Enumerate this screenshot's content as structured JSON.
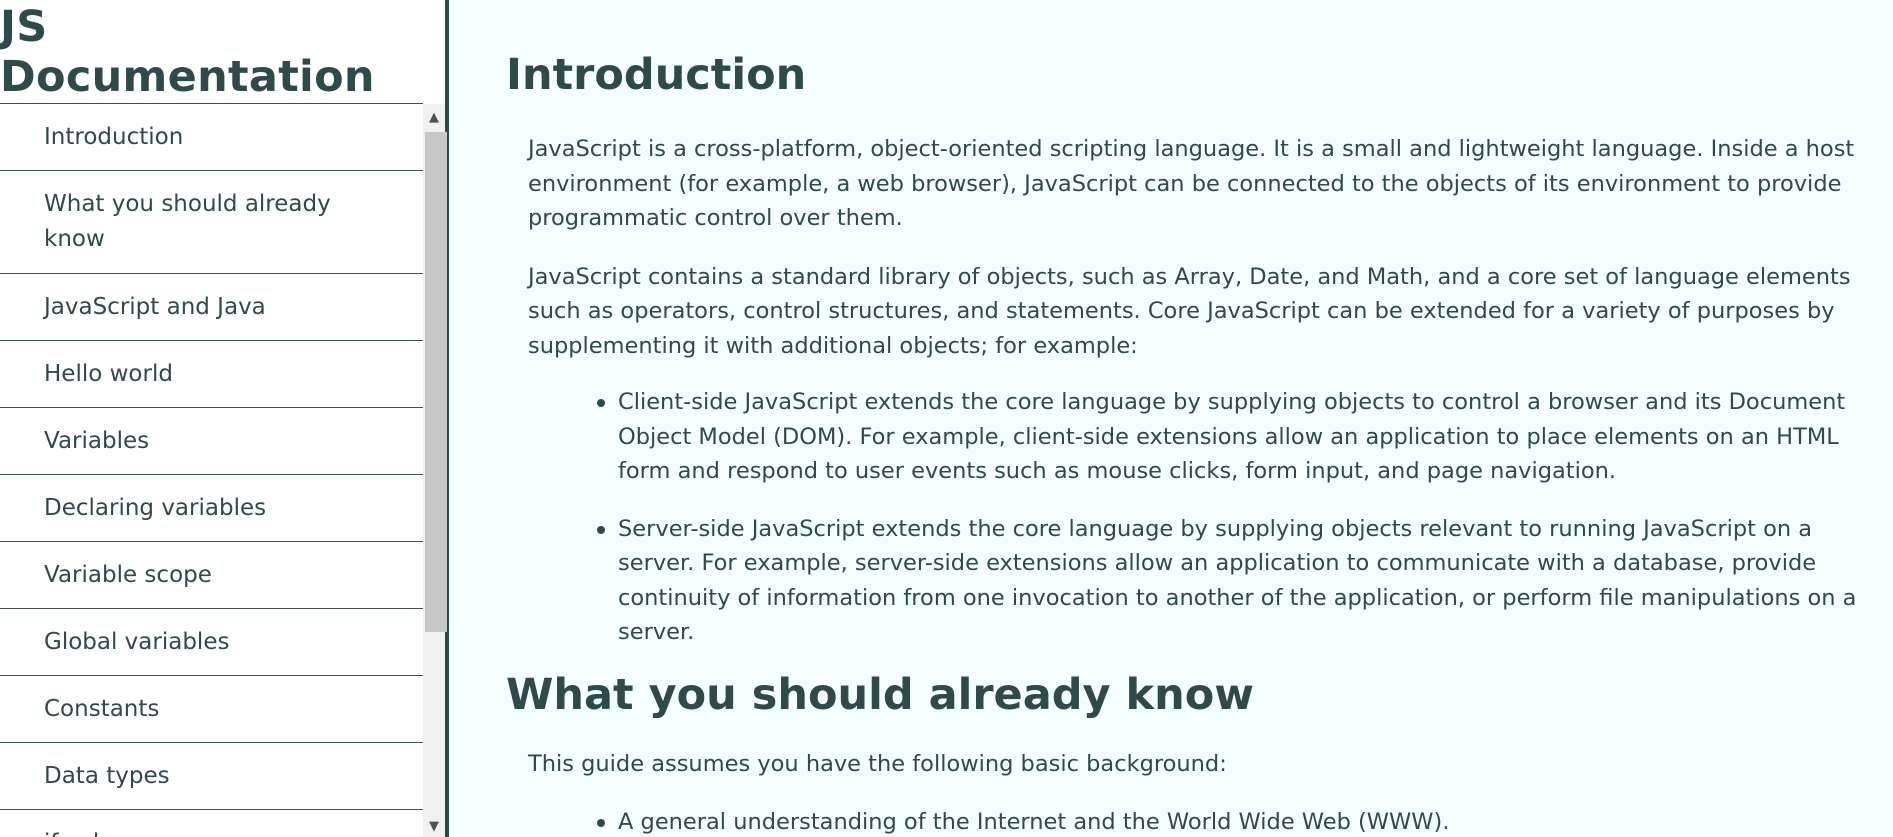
{
  "navbar": {
    "title": "JS Documentation",
    "items": [
      {
        "label": "Introduction"
      },
      {
        "label": "What you should already know"
      },
      {
        "label": "JavaScript and Java"
      },
      {
        "label": "Hello world"
      },
      {
        "label": "Variables"
      },
      {
        "label": "Declaring variables"
      },
      {
        "label": "Variable scope"
      },
      {
        "label": "Global variables"
      },
      {
        "label": "Constants"
      },
      {
        "label": "Data types"
      },
      {
        "label": "if...else"
      }
    ]
  },
  "scrollbar": {
    "up_icon": "▲",
    "down_icon": "▼"
  },
  "main": {
    "introduction": {
      "heading": "Introduction",
      "p1": "JavaScript is a cross-platform, object-oriented scripting language. It is a small and lightweight language. Inside a host environment (for example, a web browser), JavaScript can be connected to the objects of its environment to provide programmatic control over them.",
      "p2": "JavaScript contains a standard library of objects, such as Array, Date, and Math, and a core set of language elements such as operators, control structures, and statements. Core JavaScript can be extended for a variety of purposes by supplementing it with additional objects; for example:",
      "bullets": [
        "Client-side JavaScript extends the core language by supplying objects to control a browser and its Document Object Model (DOM). For example, client-side extensions allow an application to place elements on an HTML form and respond to user events such as mouse clicks, form input, and page navigation.",
        "Server-side JavaScript extends the core language by supplying objects relevant to running JavaScript on a server. For example, server-side extensions allow an application to communicate with a database, provide continuity of information from one invocation to another of the application, or perform file manipulations on a server."
      ]
    },
    "what_you_should_know": {
      "heading": "What you should already know",
      "p1": "This guide assumes you have the following basic background:",
      "bullets": [
        "A general understanding of the Internet and the World Wide Web (WWW)."
      ]
    }
  },
  "colors": {
    "page_bg": "#f5feff",
    "text": "#2f4a4a",
    "sidebar_bg": "#ffffff",
    "divider": "#3d5252",
    "scroll_thumb": "#c8c8c8"
  }
}
